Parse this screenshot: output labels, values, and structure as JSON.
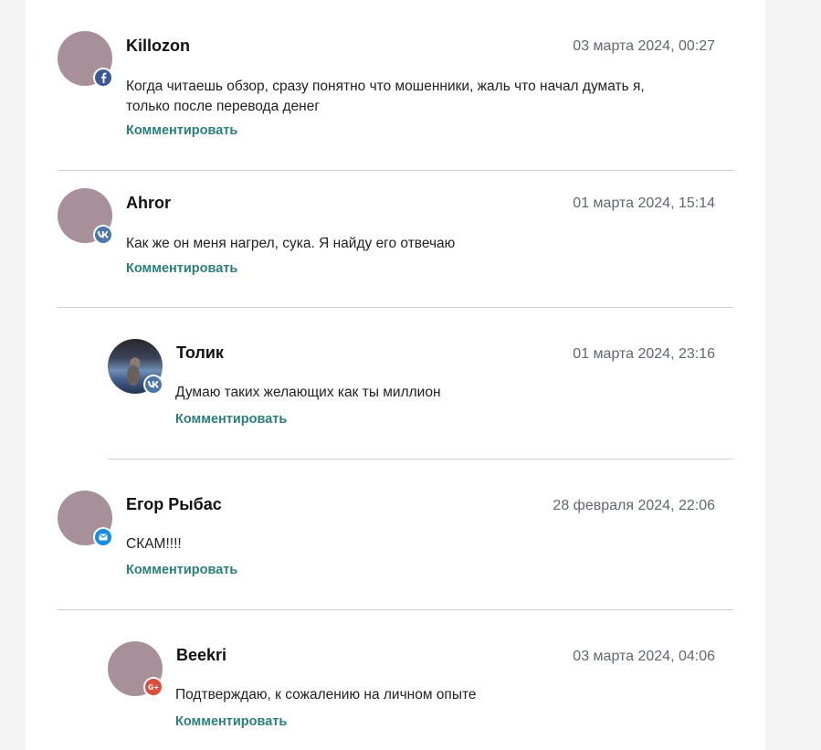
{
  "comments": [
    {
      "author": "Killozon",
      "date": "03 марта 2024, 00:27",
      "text": "Когда читаешь обзор, сразу понятно что мошенники, жаль что начал думать я, только после перевода денег",
      "reply_label": "Комментировать",
      "network": "facebook-icon",
      "level": 0
    },
    {
      "author": "Ahror",
      "date": "01 марта 2024, 15:14",
      "text": "Как же он меня нагрел, сука. Я найду его отвечаю",
      "reply_label": "Комментировать",
      "network": "vk-icon",
      "level": 0
    },
    {
      "author": "Толик",
      "date": "01 марта 2024, 23:16",
      "text": "Думаю таких желающих как ты миллион",
      "reply_label": "Комментировать",
      "network": "vk-icon",
      "level": 1
    },
    {
      "author": "Егор Рыбас",
      "date": "28 февраля 2024, 22:06",
      "text": "СКАМ!!!!",
      "reply_label": "Комментировать",
      "network": "mail-icon",
      "level": 0
    },
    {
      "author": "Beekri",
      "date": "03 марта 2024, 04:06",
      "text": "Подтверждаю, к сожалению на личном опыте",
      "reply_label": "Комментировать",
      "network": "google-plus-icon",
      "level": 1
    }
  ],
  "colors": {
    "avatar_placeholder": "#a8909b",
    "link": "#2b7f7b",
    "facebook": "#3b5998",
    "vk": "#4a76a8",
    "mail": "#168de2",
    "google_plus": "#dd4b39"
  }
}
